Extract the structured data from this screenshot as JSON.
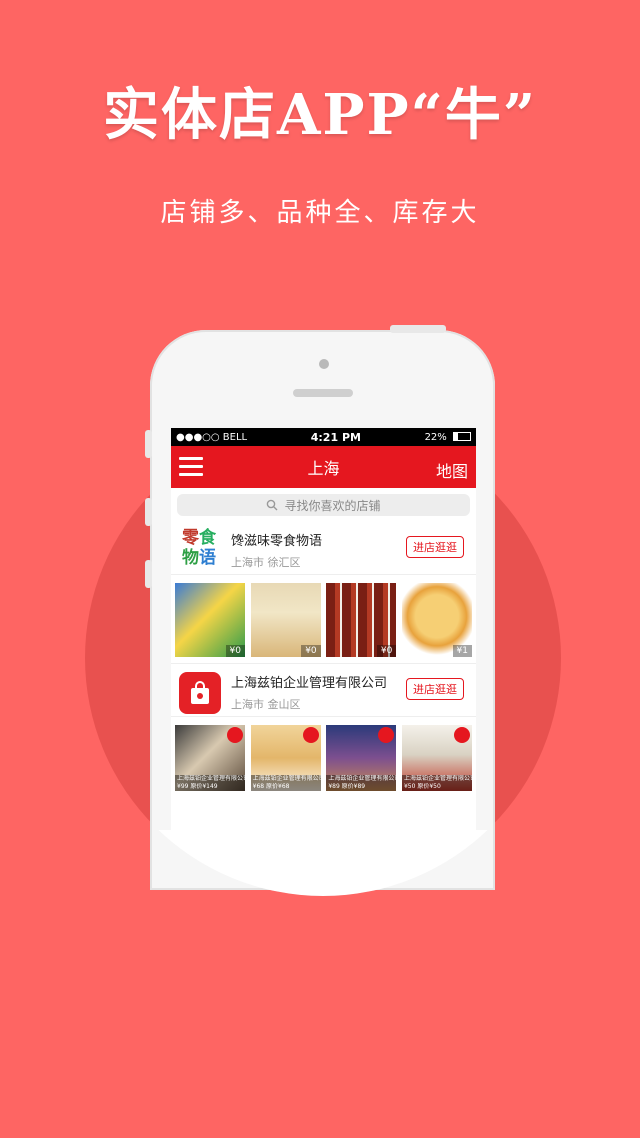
{
  "promo": {
    "headline": "实体店APP“牛”",
    "subline": "店铺多、品种全、库存大"
  },
  "status_bar": {
    "carrier": "●●●○○ BELL",
    "time": "4:21 PM",
    "battery": "22%"
  },
  "nav": {
    "menu_icon": "hamburger-icon",
    "city": "上海",
    "map_label": "地图"
  },
  "search": {
    "placeholder": "寻找你喜欢的店铺",
    "icon": "search-icon"
  },
  "stores": [
    {
      "logo_text_line1": "零食",
      "logo_text_line2": "物语",
      "name": "馋滋味零食物语",
      "city": "上海市",
      "district": "徐汇区",
      "enter_label": "进店逛逛",
      "goods": [
        {
          "price": "¥0"
        },
        {
          "price": "¥0"
        },
        {
          "price": "¥0"
        },
        {
          "price": "¥1"
        }
      ]
    },
    {
      "name": "上海兹铂企业管理有限公司",
      "city": "上海市",
      "district": "金山区",
      "enter_label": "进店逛逛",
      "goods": [
        {
          "caption_line1": "上海兹铂企业管理有限公司",
          "caption_line2": "¥99   原价¥149"
        },
        {
          "caption_line1": "上海兹铂企业管理有限公司",
          "caption_line2": "¥68   原价¥68"
        },
        {
          "caption_line1": "上海兹铂企业管理有限公司",
          "caption_line2": "¥89   原价¥89"
        },
        {
          "caption_line1": "上海兹铂企业管理有限公司",
          "caption_line2": "¥50   原价¥50"
        }
      ]
    }
  ],
  "colors": {
    "background": "#fe6563",
    "circle": "#e8514f",
    "nav_red": "#e5171f"
  }
}
